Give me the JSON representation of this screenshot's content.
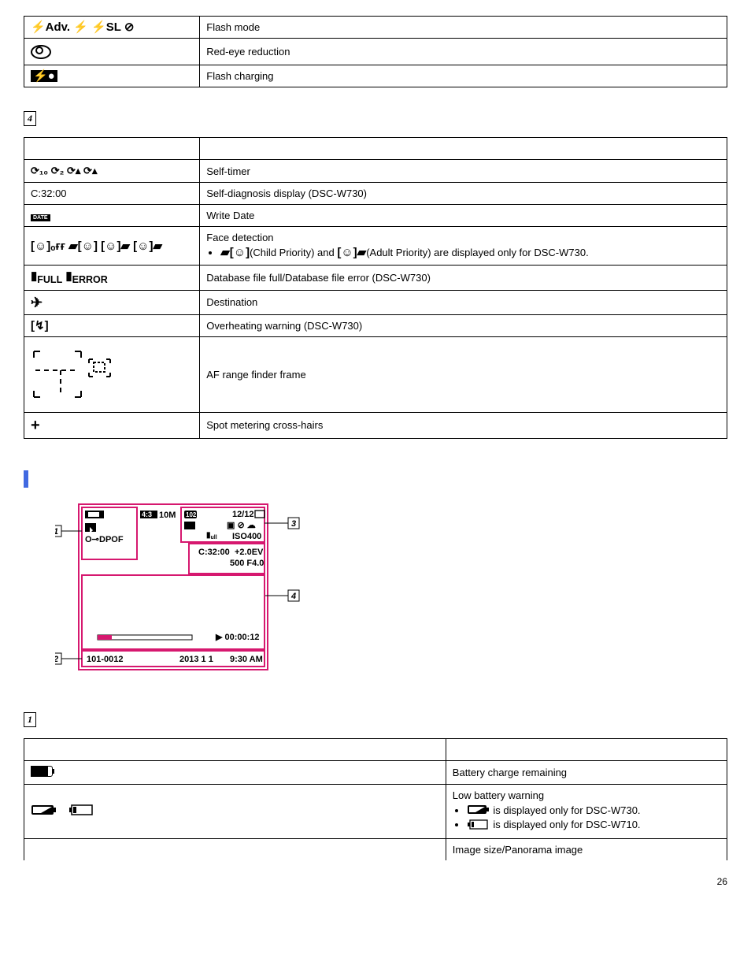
{
  "table1": {
    "r1": {
      "desc": "Flash mode"
    },
    "r2": {
      "desc": "Red-eye reduction"
    },
    "r3": {
      "desc": "Flash charging"
    }
  },
  "marker4": "4",
  "table2": {
    "r1": {
      "desc": "Self-timer"
    },
    "r2": {
      "icon": "C:32:00",
      "desc": "Self-diagnosis display (DSC-W730)"
    },
    "r3": {
      "desc": "Write Date"
    },
    "r4": {
      "desc": "Face detection",
      "note1": "(Child Priority) and ",
      "note2": "(Adult Priority) are displayed only for DSC-W730."
    },
    "r5": {
      "desc": "Database file full/Database file error (DSC-W730)"
    },
    "r6": {
      "desc": "Destination"
    },
    "r7": {
      "desc": "Overheating warning (DSC-W730)"
    },
    "r8": {
      "desc": "AF range finder frame"
    },
    "r9": {
      "desc": "Spot metering cross-hairs"
    }
  },
  "diagram": {
    "callout1": "1",
    "callout2": "2",
    "callout3": "3",
    "callout4": "4",
    "ratio": "4:3",
    "mp": "10M",
    "folder": "102",
    "count": "12/12",
    "iso": "ISO400",
    "dpof": "DPOF",
    "cdiag": "C:32:00",
    "ev": "+2.0EV",
    "shutter": "500 F4.0",
    "file": "101-0012",
    "date": "2013 1 1",
    "time": "9:30 AM",
    "playtime": "00:00:12"
  },
  "marker1": "1",
  "table3": {
    "r1": {
      "desc": "Battery charge remaining"
    },
    "r2": {
      "desc": "Low battery warning",
      "note1": " is displayed only for DSC-W730.",
      "note2": " is displayed only for DSC-W710."
    },
    "r3": {
      "desc": "Image size/Panorama image"
    }
  },
  "page": "26"
}
